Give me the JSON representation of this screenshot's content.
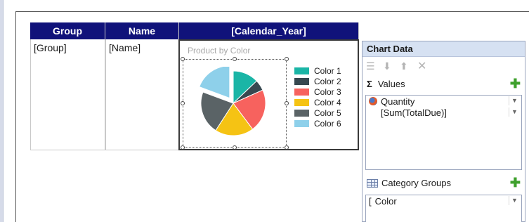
{
  "tablix": {
    "headers": [
      "Group",
      "Name",
      "[Calendar_Year]"
    ],
    "cells": [
      "[Group]",
      "[Name]"
    ]
  },
  "chart": {
    "title": "Product by Color"
  },
  "chart_data": {
    "type": "pie",
    "title": "Product by Color",
    "categories": [
      "Color 1",
      "Color 2",
      "Color 3",
      "Color 4",
      "Color 5",
      "Color 6"
    ],
    "values": [
      12,
      5,
      20,
      18,
      20,
      18
    ],
    "exploded": [
      "Color 6"
    ],
    "colors": [
      "#1ab5a6",
      "#374850",
      "#f7625e",
      "#f5c314",
      "#5a6366",
      "#8ed0ea"
    ],
    "legend": "right"
  },
  "panel": {
    "title": "Chart Data",
    "values_label": "Values",
    "values_items": [
      "Quantity",
      "[Sum(TotalDue)]"
    ],
    "category_label": "Category Groups",
    "category_items": [
      "Color"
    ]
  }
}
